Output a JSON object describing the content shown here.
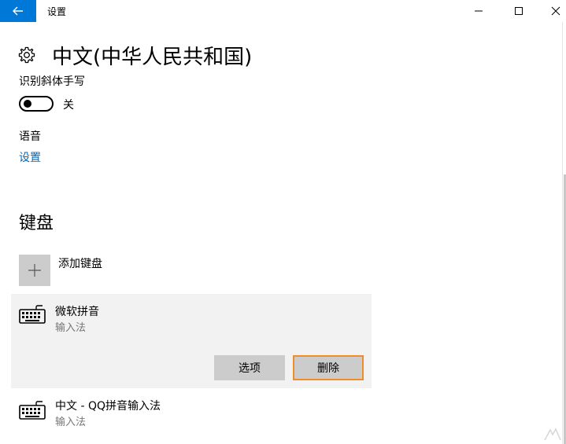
{
  "window": {
    "title": "设置"
  },
  "page": {
    "title": "中文(中华人民共和国)"
  },
  "handwriting": {
    "label": "识别斜体手写",
    "toggle_state": "关"
  },
  "voice": {
    "label": "语音",
    "link": "设置"
  },
  "keyboards": {
    "heading": "键盘",
    "add_label": "添加键盘",
    "items": [
      {
        "name": "微软拼音",
        "type": "输入法"
      },
      {
        "name": "中文 - QQ拼音输入法",
        "type": "输入法"
      }
    ],
    "options_label": "选项",
    "remove_label": "删除"
  },
  "colors": {
    "accent": "#0078d7",
    "link": "#0067b8",
    "highlight_border": "#f28c28"
  }
}
